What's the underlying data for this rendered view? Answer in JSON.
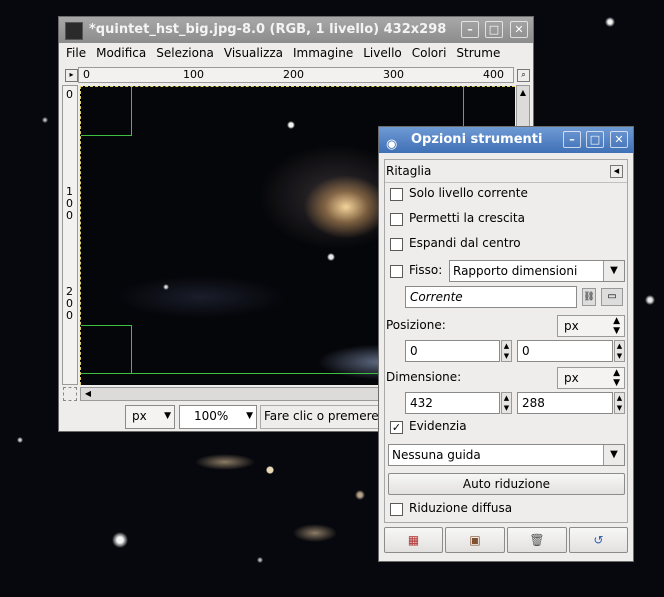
{
  "image_window": {
    "title": "*quintet_hst_big.jpg-8.0 (RGB, 1 livello) 432x298",
    "menu": [
      "File",
      "Modifica",
      "Seleziona",
      "Visualizza",
      "Immagine",
      "Livello",
      "Colori",
      "Strume"
    ],
    "ruler_h_labels": [
      "0",
      "100",
      "200",
      "300",
      "400"
    ],
    "ruler_v_labels": [
      "0",
      "1\n0\n0",
      "2\n0\n0"
    ],
    "unit": "px",
    "zoom": "100%",
    "status": "Fare clic o premere"
  },
  "tool_options": {
    "title": "Opzioni strumenti",
    "tool_name": "Ritaglia",
    "current_layer_only": "Solo livello corrente",
    "allow_growing": "Permetti la crescita",
    "expand_from_center": "Espandi dal centro",
    "fixed_label": "Fisso:",
    "fixed_mode": "Rapporto dimensioni",
    "aspect_value": "Corrente",
    "position_label": "Posizione:",
    "position_unit": "px",
    "position_x": "0",
    "position_y": "0",
    "size_label": "Dimensione:",
    "size_unit": "px",
    "size_w": "432",
    "size_h": "288",
    "highlight_label": "Evidenzia",
    "highlight_checked": true,
    "guides": "Nessuna guida",
    "auto_shrink": "Auto riduzione",
    "shrink_merged": "Riduzione diffusa"
  }
}
